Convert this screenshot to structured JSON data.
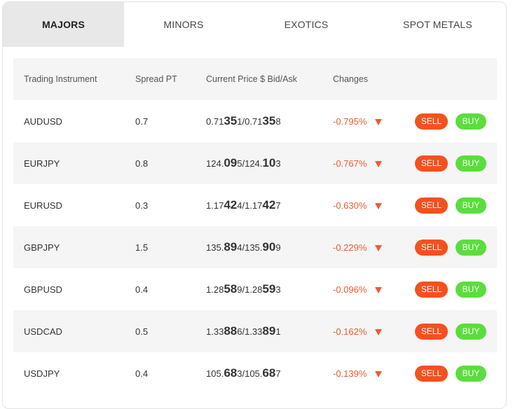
{
  "tabs": [
    {
      "label": "MAJORS",
      "active": true
    },
    {
      "label": "MINORS",
      "active": false
    },
    {
      "label": "EXOTICS",
      "active": false
    },
    {
      "label": "SPOT METALS",
      "active": false
    }
  ],
  "headers": {
    "instrument": "Trading Instrument",
    "spread": "Spread PT",
    "price": "Current Price $ Bid/Ask",
    "changes": "Changes"
  },
  "colors": {
    "sell": "#f4511e",
    "buy": "#5bdd3e",
    "change_negative": "#f25a2d",
    "active_tab": "#e8e8e8"
  },
  "rows": [
    {
      "instrument": "AUDUSD",
      "spread": "0.7",
      "bid": {
        "pre": "0.71",
        "big": "35",
        "post": "1"
      },
      "ask": {
        "pre": "0.71",
        "big": "35",
        "post": "8"
      },
      "change": "-0.795%",
      "direction_icon": "down-triangle-icon",
      "sell_label": "SELL",
      "buy_label": "BUY"
    },
    {
      "instrument": "EURJPY",
      "spread": "0.8",
      "bid": {
        "pre": "124.",
        "big": "09",
        "post": "5"
      },
      "ask": {
        "pre": "124.",
        "big": "10",
        "post": "3"
      },
      "change": "-0.767%",
      "direction_icon": "down-triangle-icon",
      "sell_label": "SELL",
      "buy_label": "BUY"
    },
    {
      "instrument": "EURUSD",
      "spread": "0.3",
      "bid": {
        "pre": "1.17",
        "big": "42",
        "post": "4"
      },
      "ask": {
        "pre": "1.17",
        "big": "42",
        "post": "7"
      },
      "change": "-0.630%",
      "direction_icon": "down-triangle-icon",
      "sell_label": "SELL",
      "buy_label": "BUY"
    },
    {
      "instrument": "GBPJPY",
      "spread": "1.5",
      "bid": {
        "pre": "135.",
        "big": "89",
        "post": "4"
      },
      "ask": {
        "pre": "135.",
        "big": "90",
        "post": "9"
      },
      "change": "-0.229%",
      "direction_icon": "down-triangle-icon",
      "sell_label": "SELL",
      "buy_label": "BUY"
    },
    {
      "instrument": "GBPUSD",
      "spread": "0.4",
      "bid": {
        "pre": "1.28",
        "big": "58",
        "post": "9"
      },
      "ask": {
        "pre": "1.28",
        "big": "59",
        "post": "3"
      },
      "change": "-0.096%",
      "direction_icon": "down-triangle-icon",
      "sell_label": "SELL",
      "buy_label": "BUY"
    },
    {
      "instrument": "USDCAD",
      "spread": "0.5",
      "bid": {
        "pre": "1.33",
        "big": "88",
        "post": "6"
      },
      "ask": {
        "pre": "1.33",
        "big": "89",
        "post": "1"
      },
      "change": "-0.162%",
      "direction_icon": "down-triangle-icon",
      "sell_label": "SELL",
      "buy_label": "BUY"
    },
    {
      "instrument": "USDJPY",
      "spread": "0.4",
      "bid": {
        "pre": "105.",
        "big": "68",
        "post": "3"
      },
      "ask": {
        "pre": "105.",
        "big": "68",
        "post": "7"
      },
      "change": "-0.139%",
      "direction_icon": "down-triangle-icon",
      "sell_label": "SELL",
      "buy_label": "BUY"
    }
  ]
}
